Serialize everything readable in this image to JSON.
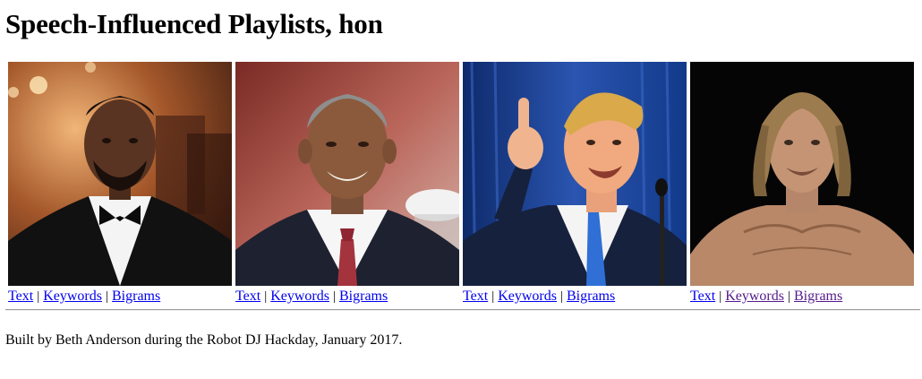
{
  "page": {
    "title": "Speech-Influenced Playlists, hon"
  },
  "cards": [
    {
      "image": "portrait-photo-1",
      "links": {
        "text": "Text",
        "keywords": "Keywords",
        "bigrams": "Bigrams"
      },
      "separator": "|",
      "link_color": "#0000ee"
    },
    {
      "image": "portrait-photo-2",
      "links": {
        "text": "Text",
        "keywords": "Keywords",
        "bigrams": "Bigrams"
      },
      "separator": "|",
      "link_color": "#0000ee"
    },
    {
      "image": "portrait-photo-3",
      "links": {
        "text": "Text",
        "keywords": "Keywords",
        "bigrams": "Bigrams"
      },
      "separator": "|",
      "link_color": "#0000ee"
    },
    {
      "image": "portrait-photo-4",
      "links": {
        "text": "Text",
        "keywords": "Keywords",
        "bigrams": "Bigrams"
      },
      "separator": "|",
      "link_color": "#0000ee",
      "visited_link_color": "#551a8b"
    }
  ],
  "footer": {
    "text": "Built by Beth Anderson during the Robot DJ Hackday, January 2017."
  }
}
